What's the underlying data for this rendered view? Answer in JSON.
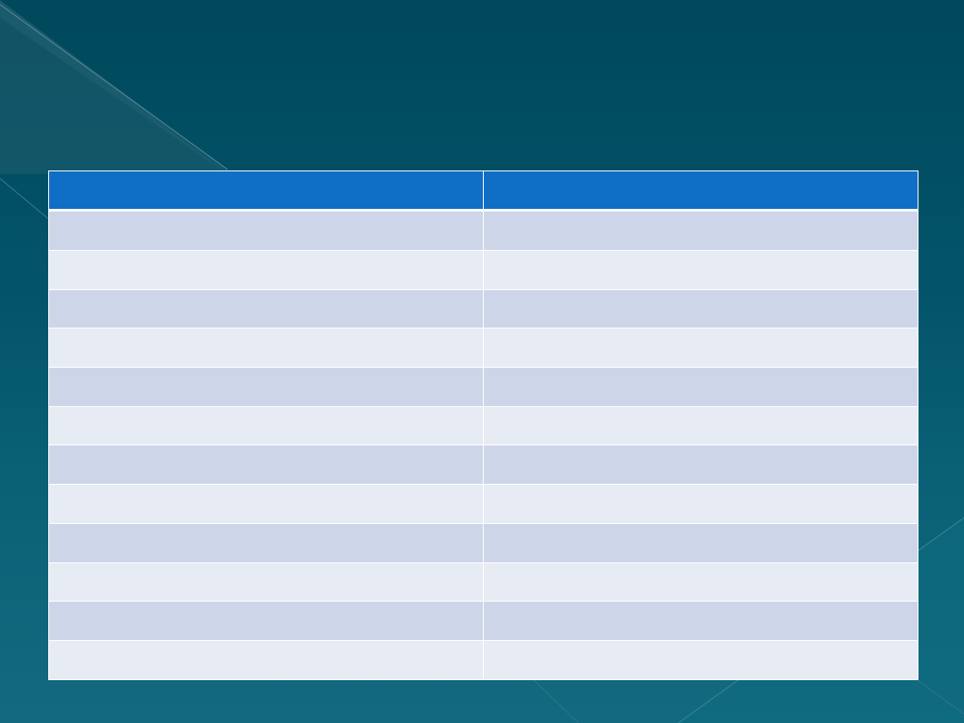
{
  "slide": {
    "background_color": "#00485b",
    "header_color": "#0f6ec6",
    "band_dark": "#cdd5e9",
    "band_light": "#e7ebf4"
  },
  "table": {
    "headers": [
      "",
      ""
    ],
    "rows": [
      [
        "",
        ""
      ],
      [
        "",
        ""
      ],
      [
        "",
        ""
      ],
      [
        "",
        ""
      ],
      [
        "",
        ""
      ],
      [
        "",
        ""
      ],
      [
        "",
        ""
      ],
      [
        "",
        ""
      ],
      [
        "",
        ""
      ],
      [
        "",
        ""
      ],
      [
        "",
        ""
      ],
      [
        "",
        ""
      ]
    ]
  }
}
